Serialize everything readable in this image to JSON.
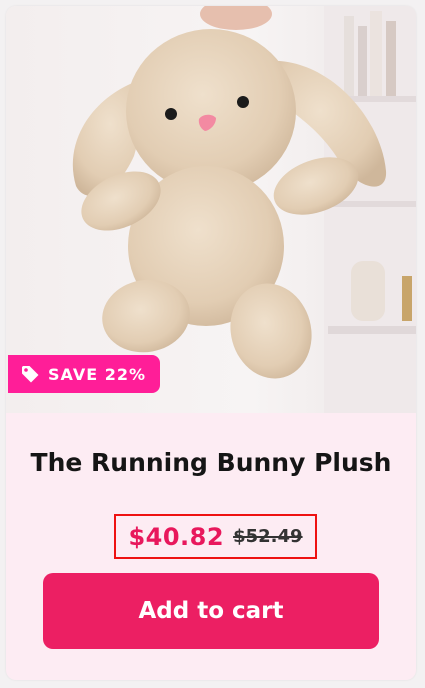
{
  "product": {
    "image_subject": "plush-bunny-photo",
    "badge": {
      "icon": "tag-icon",
      "text": "SAVE 22%",
      "color": "#ff1e98"
    },
    "title": "The Running Bunny Plush",
    "price": {
      "sale": "$40.82",
      "compare": "$52.49",
      "sale_color": "#e8185c"
    },
    "add_to_cart_label": "Add to cart",
    "button_color": "#ec1f63"
  }
}
